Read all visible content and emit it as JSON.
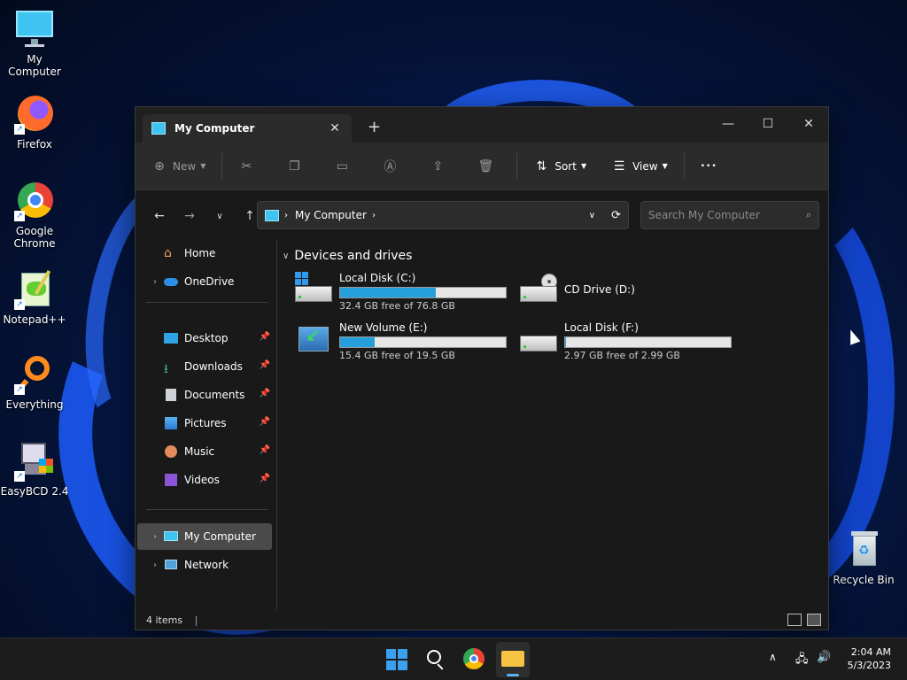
{
  "desktop": {
    "icons": [
      {
        "label": "My Computer"
      },
      {
        "label": "Firefox"
      },
      {
        "label": "Google Chrome"
      },
      {
        "label": "Notepad++"
      },
      {
        "label": "Everything"
      },
      {
        "label": "EasyBCD 2.4"
      },
      {
        "label": "Recycle Bin"
      }
    ]
  },
  "window": {
    "tab_title": "My Computer",
    "toolbar": {
      "new_label": "New",
      "sort_label": "Sort",
      "view_label": "View",
      "more_label": "•••"
    },
    "address": {
      "path_label": "My Computer"
    },
    "search": {
      "placeholder": "Search My Computer"
    },
    "sidebar": {
      "home": "Home",
      "onedrive": "OneDrive",
      "desktop": "Desktop",
      "downloads": "Downloads",
      "documents": "Documents",
      "pictures": "Pictures",
      "music": "Music",
      "videos": "Videos",
      "my_computer": "My Computer",
      "network": "Network"
    },
    "content": {
      "group_label": "Devices and drives",
      "drives": [
        {
          "name": "Local Disk (C:)",
          "free": "32.4 GB free of 76.8 GB",
          "used_fraction": 0.578
        },
        {
          "name": "CD Drive (D:)"
        },
        {
          "name": "New Volume (E:)",
          "free": "15.4 GB free of 19.5 GB",
          "used_fraction": 0.21
        },
        {
          "name": "Local Disk (F:)",
          "free": "2.97 GB free of 2.99 GB",
          "used_fraction": 0.007
        }
      ]
    },
    "status": {
      "items_text": "4 items"
    }
  },
  "taskbar": {
    "time": "2:04 AM",
    "date": "5/3/2023"
  },
  "colors": {
    "accent": "#26a0da",
    "window_bg": "#191919",
    "taskbar_bg": "#1c1c1c"
  }
}
